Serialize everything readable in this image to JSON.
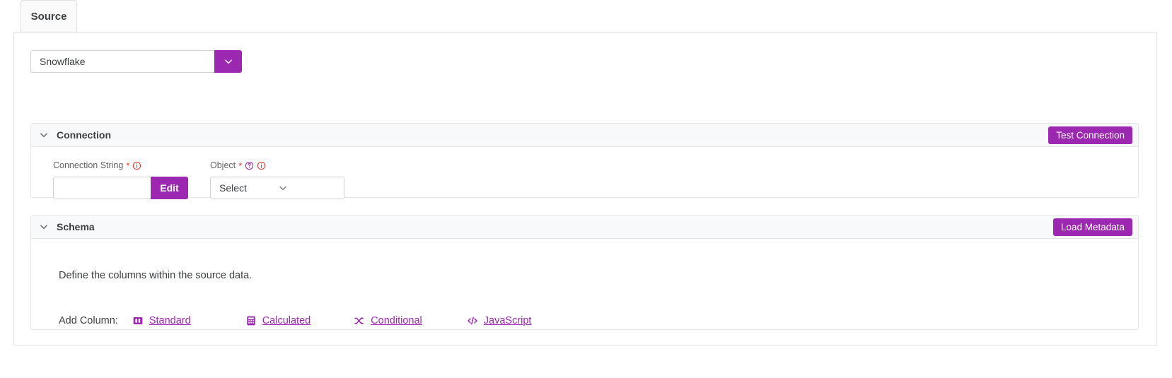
{
  "theme": {
    "accent": "#9c27b0",
    "required_red": "#e53935",
    "text": "#3c4043",
    "muted_text": "#5f6368",
    "border": "#e0e0e0",
    "panel_header_bg": "#f8f9fa"
  },
  "tabs": [
    {
      "label": "Source",
      "active": true
    }
  ],
  "datasource": {
    "value": "Snowflake",
    "caret_icon": "chevron-down-icon"
  },
  "connection": {
    "title": "Connection",
    "collapse_icon": "chevron-down-icon",
    "test_button": "Test Connection",
    "fields": [
      {
        "label": "Connection String",
        "required": true,
        "required_marker": "*",
        "icons": [
          "info-icon"
        ],
        "value": "",
        "placeholder": "",
        "button": "Edit"
      },
      {
        "label": "Object",
        "required": true,
        "required_marker": "*",
        "icons": [
          "help-icon",
          "info-icon"
        ],
        "value": "Select",
        "caret_icon": "chevron-down-icon"
      }
    ]
  },
  "schema": {
    "title": "Schema",
    "collapse_icon": "chevron-down-icon",
    "load_button": "Load Metadata",
    "description": "Define the columns within the source data.",
    "add_column_label": "Add Column:",
    "add_column_links": [
      {
        "label": "Standard",
        "icon": "columns-icon"
      },
      {
        "label": "Calculated",
        "icon": "calculator-icon"
      },
      {
        "label": "Conditional",
        "icon": "shuffle-icon"
      },
      {
        "label": "JavaScript",
        "icon": "code-icon"
      }
    ]
  }
}
